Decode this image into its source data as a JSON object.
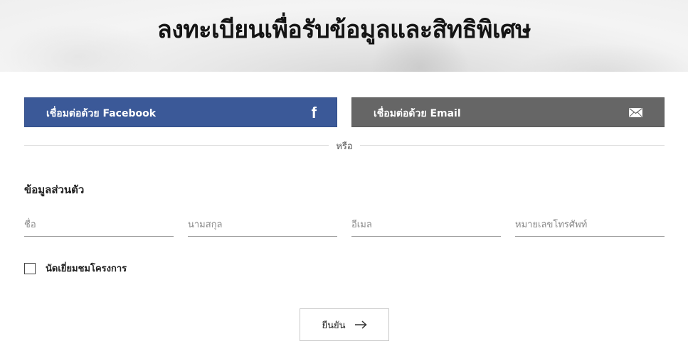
{
  "hero": {
    "title": "ลงทะเบียนเพื่อรับข้อมูลและสิทธิพิเศษ"
  },
  "social": {
    "facebook_label": "เชื่อมต่อด้วย Facebook",
    "facebook_icon": "facebook-icon",
    "email_label": "เชื่อมต่อด้วย Email",
    "email_icon": "envelope-icon",
    "facebook_color": "#3b5998",
    "email_color": "#666666"
  },
  "divider": {
    "or_text": "หรือ"
  },
  "form": {
    "section_title": "ข้อมูลส่วนตัว",
    "fields": [
      {
        "placeholder": "ชื่อ",
        "value": ""
      },
      {
        "placeholder": "นามสกุล",
        "value": ""
      },
      {
        "placeholder": "อีเมล",
        "value": ""
      },
      {
        "placeholder": "หมายเลขโทรศัพท์",
        "value": ""
      }
    ],
    "checkbox_label": "นัดเยี่ยมชมโครงการ",
    "checkbox_checked": false,
    "submit_label": "ยืนยัน",
    "submit_icon": "arrow-right-icon"
  }
}
